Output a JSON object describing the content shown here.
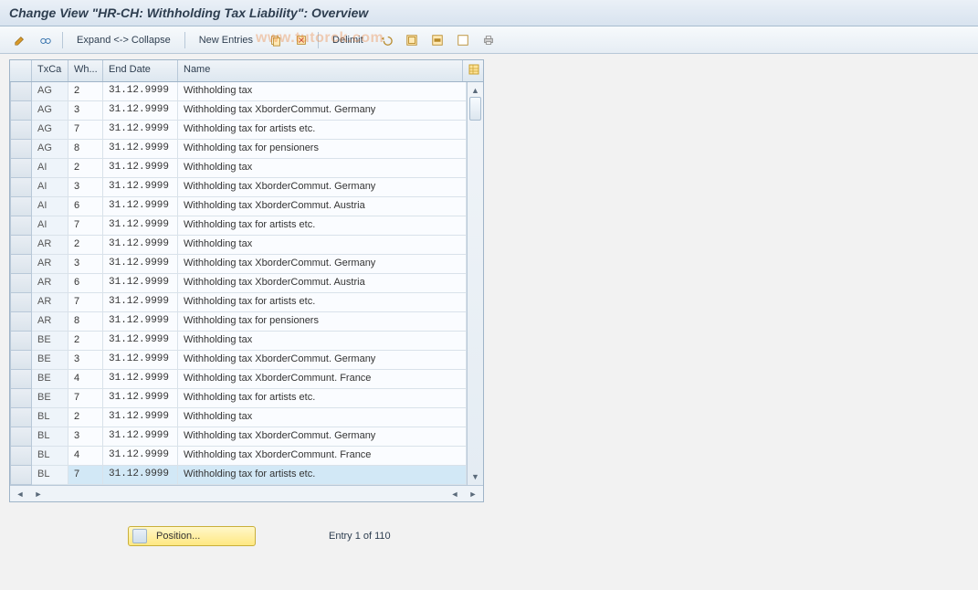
{
  "title": "Change View \"HR-CH: Withholding Tax Liability\": Overview",
  "toolbar": {
    "expand_collapse": "Expand <-> Collapse",
    "new_entries": "New Entries",
    "delimit": "Delimit"
  },
  "watermark": "www.tutorck.com",
  "columns": {
    "txca": "TxCa",
    "wh": "Wh...",
    "end": "End Date",
    "name": "Name"
  },
  "rows": [
    {
      "txca": "AG",
      "wh": "2",
      "end": "31.12.9999",
      "name": "Withholding tax"
    },
    {
      "txca": "AG",
      "wh": "3",
      "end": "31.12.9999",
      "name": "Withholding tax XborderCommut. Germany"
    },
    {
      "txca": "AG",
      "wh": "7",
      "end": "31.12.9999",
      "name": "Withholding tax for artists etc."
    },
    {
      "txca": "AG",
      "wh": "8",
      "end": "31.12.9999",
      "name": "Withholding tax for pensioners"
    },
    {
      "txca": "AI",
      "wh": "2",
      "end": "31.12.9999",
      "name": "Withholding tax"
    },
    {
      "txca": "AI",
      "wh": "3",
      "end": "31.12.9999",
      "name": "Withholding tax XborderCommut. Germany"
    },
    {
      "txca": "AI",
      "wh": "6",
      "end": "31.12.9999",
      "name": "Withholding tax XborderCommut. Austria"
    },
    {
      "txca": "AI",
      "wh": "7",
      "end": "31.12.9999",
      "name": "Withholding tax for artists etc."
    },
    {
      "txca": "AR",
      "wh": "2",
      "end": "31.12.9999",
      "name": "Withholding tax"
    },
    {
      "txca": "AR",
      "wh": "3",
      "end": "31.12.9999",
      "name": "Withholding tax XborderCommut. Germany"
    },
    {
      "txca": "AR",
      "wh": "6",
      "end": "31.12.9999",
      "name": "Withholding tax XborderCommut. Austria"
    },
    {
      "txca": "AR",
      "wh": "7",
      "end": "31.12.9999",
      "name": "Withholding tax for artists etc."
    },
    {
      "txca": "AR",
      "wh": "8",
      "end": "31.12.9999",
      "name": "Withholding tax for pensioners"
    },
    {
      "txca": "BE",
      "wh": "2",
      "end": "31.12.9999",
      "name": "Withholding tax"
    },
    {
      "txca": "BE",
      "wh": "3",
      "end": "31.12.9999",
      "name": "Withholding tax XborderCommut. Germany"
    },
    {
      "txca": "BE",
      "wh": "4",
      "end": "31.12.9999",
      "name": "Withholding tax XborderCommunt. France"
    },
    {
      "txca": "BE",
      "wh": "7",
      "end": "31.12.9999",
      "name": "Withholding tax for artists etc."
    },
    {
      "txca": "BL",
      "wh": "2",
      "end": "31.12.9999",
      "name": "Withholding tax"
    },
    {
      "txca": "BL",
      "wh": "3",
      "end": "31.12.9999",
      "name": "Withholding tax XborderCommut. Germany"
    },
    {
      "txca": "BL",
      "wh": "4",
      "end": "31.12.9999",
      "name": "Withholding tax XborderCommunt. France"
    },
    {
      "txca": "BL",
      "wh": "7",
      "end": "31.12.9999",
      "name": "Withholding tax for artists etc."
    }
  ],
  "selected_row_index": 20,
  "position_button": "Position...",
  "entry_status": "Entry 1 of 110"
}
